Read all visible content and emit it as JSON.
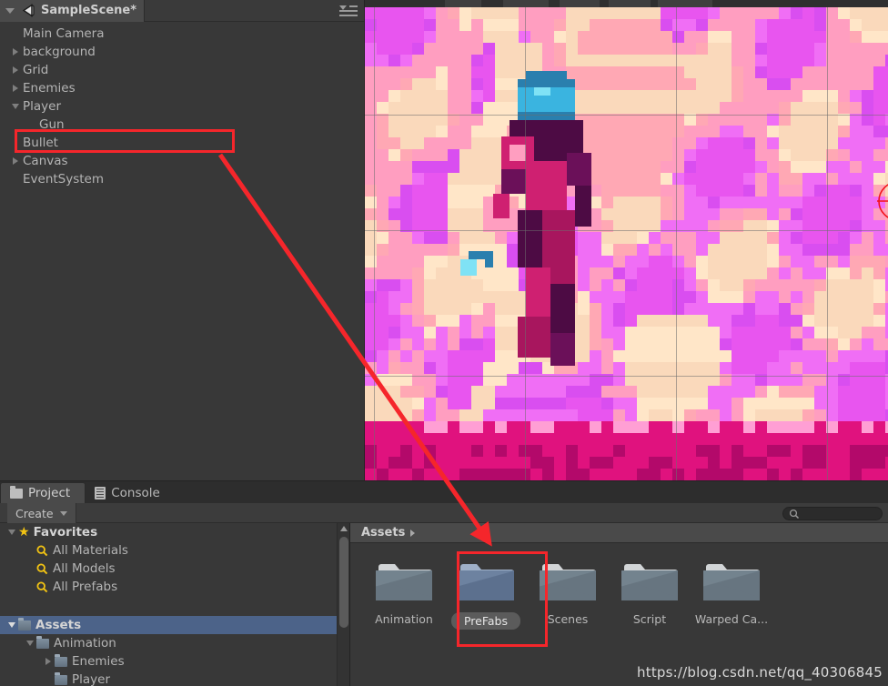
{
  "hierarchy": {
    "tab_label": "SampleScene*",
    "logo_icon": "unity-logo-icon",
    "menu_icon": "hamburger-menu-icon",
    "items": [
      {
        "label": "Main Camera",
        "indent": 1,
        "toggle": "none"
      },
      {
        "label": "background",
        "indent": 1,
        "toggle": "right"
      },
      {
        "label": "Grid",
        "indent": 1,
        "toggle": "right"
      },
      {
        "label": "Enemies",
        "indent": 1,
        "toggle": "right"
      },
      {
        "label": "Player",
        "indent": 1,
        "toggle": "down"
      },
      {
        "label": "Gun",
        "indent": 2,
        "toggle": "none"
      },
      {
        "label": "Bullet",
        "indent": 1,
        "toggle": "none"
      },
      {
        "label": "Canvas",
        "indent": 1,
        "toggle": "right"
      },
      {
        "label": "EventSystem",
        "indent": 1,
        "toggle": "none"
      }
    ],
    "highlighted_item": "Bullet"
  },
  "scene": {
    "gizmo_icon": "crosshair-gizmo-icon",
    "grid_color": "#6e6e6e"
  },
  "project": {
    "tabs": [
      {
        "label": "Project",
        "icon": "folder-icon",
        "active": true
      },
      {
        "label": "Console",
        "icon": "console-icon",
        "active": false
      }
    ],
    "create_label": "Create",
    "search": {
      "value": "",
      "placeholder": "",
      "icon": "search-icon"
    },
    "tree": [
      {
        "label": "Favorites",
        "indent": 0,
        "toggle": "down",
        "icon": "star-icon",
        "bold": true,
        "selected": false
      },
      {
        "label": "All Materials",
        "indent": 1,
        "toggle": "none",
        "icon": "search-icon",
        "bold": false,
        "selected": false
      },
      {
        "label": "All Models",
        "indent": 1,
        "toggle": "none",
        "icon": "search-icon",
        "bold": false,
        "selected": false
      },
      {
        "label": "All Prefabs",
        "indent": 1,
        "toggle": "none",
        "icon": "search-icon",
        "bold": false,
        "selected": false
      },
      {
        "label": "",
        "indent": 0,
        "toggle": "none",
        "icon": "none",
        "bold": false,
        "selected": false
      },
      {
        "label": "Assets",
        "indent": 0,
        "toggle": "down",
        "icon": "folder-icon",
        "bold": true,
        "selected": true
      },
      {
        "label": "Animation",
        "indent": 1,
        "toggle": "down",
        "icon": "folder-icon",
        "bold": false,
        "selected": false
      },
      {
        "label": "Enemies",
        "indent": 2,
        "toggle": "right",
        "icon": "folder-icon",
        "bold": false,
        "selected": false
      },
      {
        "label": "Player",
        "indent": 2,
        "toggle": "none",
        "icon": "folder-icon",
        "bold": false,
        "selected": false
      }
    ],
    "breadcrumb": {
      "root": "Assets",
      "caret_icon": "chevron-right-icon"
    },
    "assets": [
      {
        "label": "Animation",
        "icon": "folder-icon",
        "selected": false
      },
      {
        "label": "PreFabs",
        "icon": "folder-icon",
        "selected": true
      },
      {
        "label": "Scenes",
        "icon": "folder-icon",
        "selected": false
      },
      {
        "label": "Script",
        "icon": "folder-icon",
        "selected": false
      },
      {
        "label": "Warped Ca...",
        "icon": "folder-icon",
        "selected": false
      }
    ],
    "selected_asset": "PreFabs",
    "scrollbar": {
      "up_icon": "scroll-up-arrow-icon"
    }
  },
  "annotation": {
    "color": "#f5262b",
    "arrow_from": "Bullet",
    "arrow_to": "PreFabs"
  },
  "watermark": "https://blog.csdn.net/qq_40306845",
  "colors": {
    "accent_red": "#f5262b",
    "selection_blue": "#4c6389",
    "panel_bg": "#383838",
    "toolbar_bg": "#3c3c3c"
  }
}
